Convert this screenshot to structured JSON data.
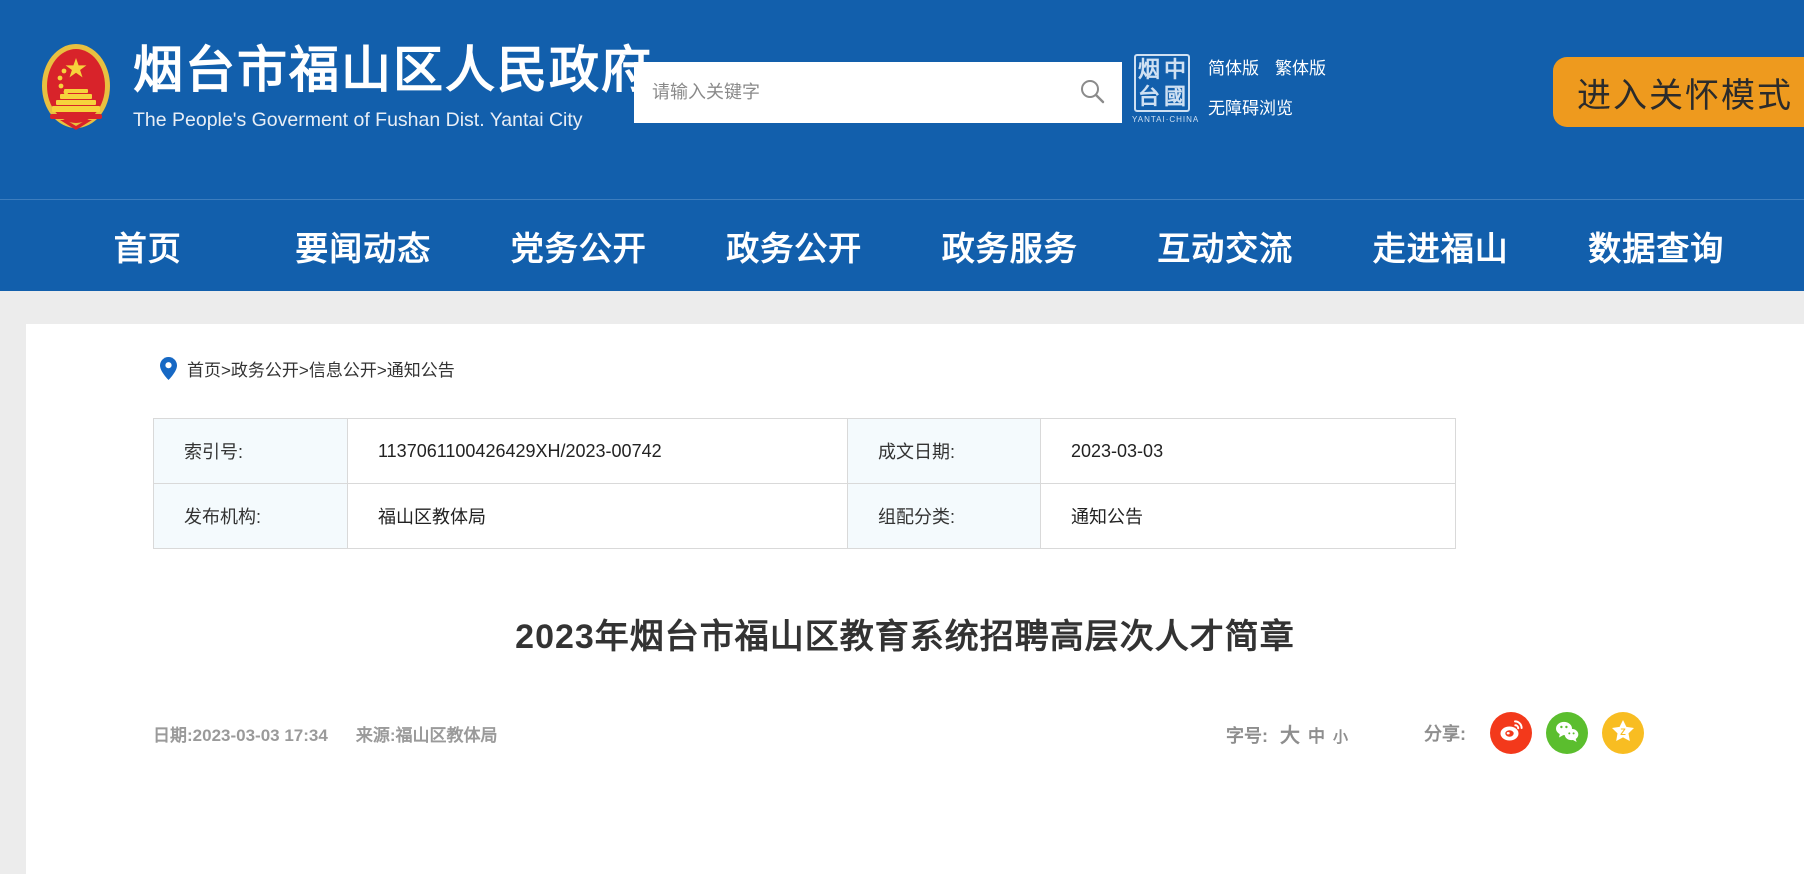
{
  "header": {
    "emblem_icon": "china-national-emblem",
    "site_title_cn": "烟台市福山区人民政府",
    "site_title_en": "The People's Goverment of Fushan Dist. Yantai City",
    "search": {
      "placeholder": "请输入关键字",
      "value": "",
      "button_icon": "search-icon"
    },
    "seal": {
      "char_1": "烟",
      "char_2": "中",
      "char_3": "台",
      "char_4": "國",
      "caption": "YANTAI·CHINA"
    },
    "lang_links": [
      "简体版",
      "繁体版"
    ],
    "accessibility_link": "无障碍浏览",
    "care_mode_button": "进入关怀模式",
    "colors": {
      "header_blue": "#125FAC",
      "care_orange": "#EE9A1E"
    }
  },
  "nav": {
    "items": [
      "首页",
      "要闻动态",
      "党务公开",
      "政务公开",
      "政务服务",
      "互动交流",
      "走进福山",
      "数据查询"
    ]
  },
  "breadcrumb": {
    "pin_icon": "location-pin-icon",
    "text": "首页>政务公开>信息公开>通知公告"
  },
  "info_table": {
    "rows": [
      {
        "label_left": "索引号:",
        "value_left": "1137061100426429XH/2023-00742",
        "label_right": "成文日期:",
        "value_right": "2023-03-03"
      },
      {
        "label_left": "发布机构:",
        "value_left": "福山区教体局",
        "label_right": "组配分类:",
        "value_right": "通知公告"
      }
    ]
  },
  "article": {
    "title": "2023年烟台市福山区教育系统招聘高层次人才简章",
    "date": "日期:2023-03-03 17:34",
    "source": "来源:福山区教体局"
  },
  "tools": {
    "fontsize_label": "字号:",
    "fontsize_options": [
      "大",
      "中",
      "小"
    ],
    "share_label": "分享:",
    "share_targets": [
      {
        "name": "weibo",
        "icon": "weibo-icon",
        "color": "#F3391B"
      },
      {
        "name": "wechat",
        "icon": "wechat-icon",
        "color": "#5BBE2E"
      },
      {
        "name": "qzone",
        "icon": "qzone-star-icon",
        "color": "#F8BD22"
      }
    ]
  }
}
